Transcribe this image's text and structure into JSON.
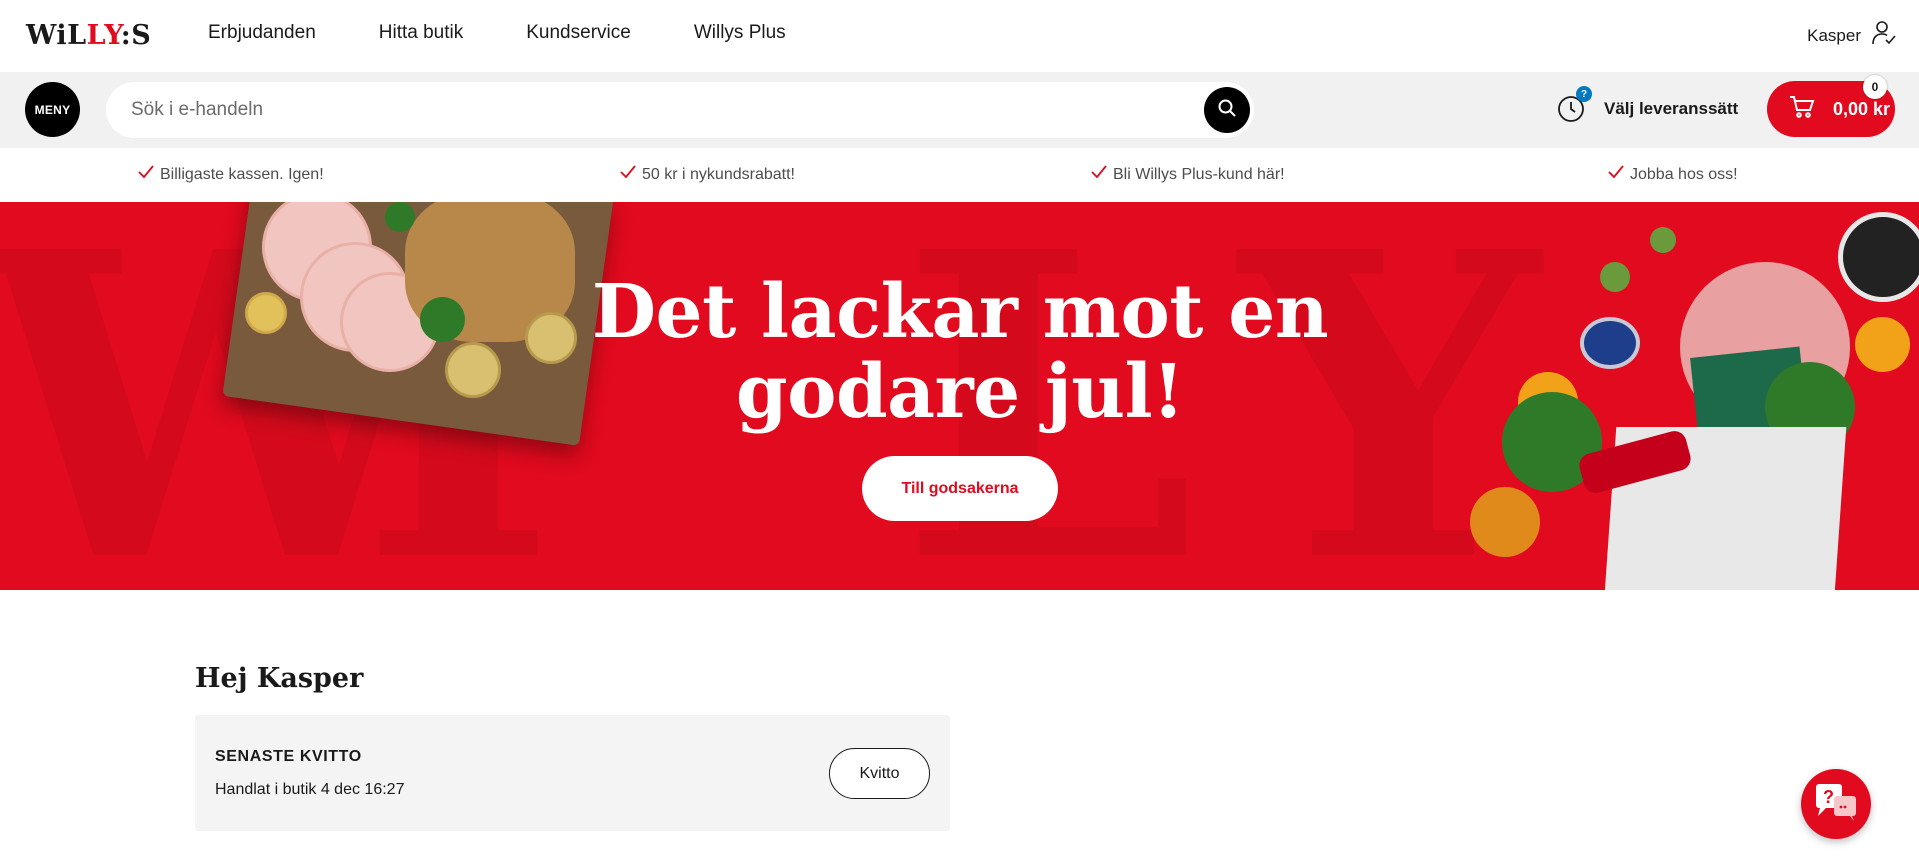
{
  "brand": {
    "logo_left": "WiL",
    "logo_mid": "LY",
    "logo_right": ":S",
    "accent": "#e10a1e"
  },
  "nav": [
    {
      "label": "Erbjudanden"
    },
    {
      "label": "Hitta butik"
    },
    {
      "label": "Kundservice"
    },
    {
      "label": "Willys Plus"
    }
  ],
  "user": {
    "name": "Kasper"
  },
  "menu": {
    "label": "MENY"
  },
  "search": {
    "placeholder": "Sök i e-handeln"
  },
  "delivery": {
    "label": "Välj leveranssätt",
    "badge": "?"
  },
  "cart": {
    "total": "0,00 kr",
    "count": "0"
  },
  "usps": [
    {
      "label": "Billigaste kassen. Igen!"
    },
    {
      "label": "50 kr i nykundsrabatt!"
    },
    {
      "label": "Bli Willys Plus-kund här!"
    },
    {
      "label": "Jobba hos oss!"
    }
  ],
  "hero": {
    "title_line1": "Det lackar mot en",
    "title_line2": "godare jul!",
    "button": "Till godsakerna",
    "background_color": "#e10a1e"
  },
  "greeting": "Hej Kasper",
  "receipt": {
    "title": "SENASTE KVITTO",
    "subtitle": "Handlat i butik 4 dec 16:27",
    "button": "Kvitto"
  },
  "chat": {
    "icon": "chat-help-icon"
  }
}
